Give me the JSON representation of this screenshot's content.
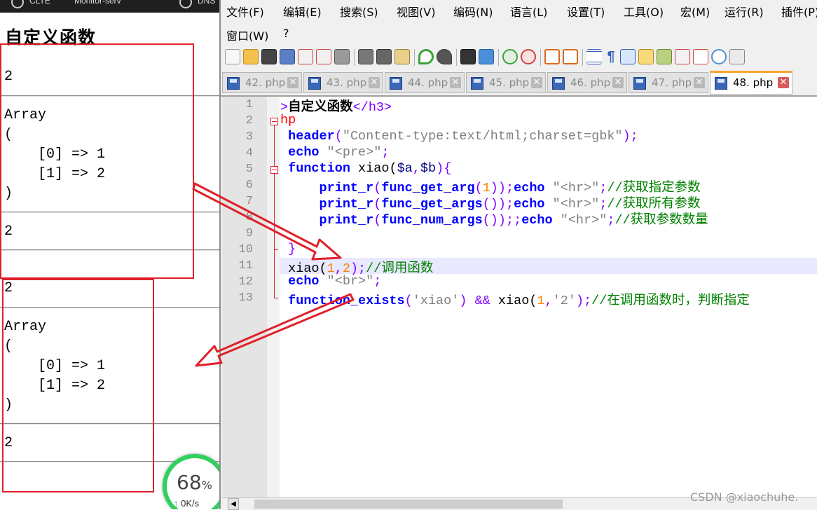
{
  "browser": {
    "tabs": [
      "CLTE",
      "Monitor-serv",
      "DNS"
    ],
    "heading": "自定义函数",
    "outputs": [
      "2",
      "Array\n(\n    [0] => 1\n    [1] => 2\n)",
      "2"
    ]
  },
  "network_widget": {
    "percent": "68",
    "percent_unit": "%",
    "speed": "0K/s"
  },
  "editor": {
    "menus": [
      "文件(F)",
      "编辑(E)",
      "搜索(S)",
      "视图(V)",
      "编码(N)",
      "语言(L)",
      "设置(T)",
      "工具(O)",
      "宏(M)",
      "运行(R)",
      "插件(P)",
      "窗口(W)",
      "?"
    ],
    "tabs": [
      "42. php",
      "43. php",
      "44. php",
      "45. php",
      "46. php",
      "47. php",
      "48. php"
    ],
    "active_tab": "48. php",
    "line_numbers": [
      "1",
      "2",
      "3",
      "4",
      "5",
      "6",
      "7",
      "8",
      "9",
      "10",
      "11",
      "12",
      "13"
    ],
    "code": {
      "l1": {
        "gt": ">",
        "text": "自定义函数",
        "close_tag": "</h3>"
      },
      "l2": {
        "text": "hp"
      },
      "l3": {
        "fn": "header",
        "open": "(",
        "str": "\"Content-type:text/html;charset=gbk\"",
        "close": ");"
      },
      "l4": {
        "kw": "echo",
        "str": "\"<pre>\"",
        "end": ";"
      },
      "l5": {
        "kw": "function",
        "name": " xiao(",
        "var_a": "$a",
        "comma": ",",
        "var_b": "$b",
        "end": "){"
      },
      "l6": {
        "fn1": "print_r",
        "p1": "(",
        "fn2": "func_get_arg",
        "p2": "(",
        "num": "1",
        "p3": "));",
        "kw": "echo",
        "str": " \"<hr>\"",
        "semi": ";",
        "comment": "//获取指定参数"
      },
      "l7": {
        "fn1": "print_r",
        "p1": "(",
        "fn2": "func_get_args",
        "p2": "());",
        "kw": "echo",
        "str": " \"<hr>\"",
        "semi": ";",
        "comment": "//获取所有参数"
      },
      "l8": {
        "fn1": "print_r",
        "p1": "(",
        "fn2": "func_num_args",
        "p2": "());;",
        "kw": "echo",
        "str": " \"<hr>\"",
        "semi": ";",
        "comment": "//获取参数数量"
      },
      "l10": {
        "brace": "}"
      },
      "l11": {
        "call": "xiao(",
        "n1": "1",
        "comma": ",",
        "n2": "2",
        "end": ");",
        "comment": "//调用函数"
      },
      "l12": {
        "kw": "echo",
        "str": " \"<br>\"",
        "end": ";"
      },
      "l13": {
        "kw": "function_exists",
        "open": "(",
        "str1": "'xiao'",
        "mid": ") && ",
        "call": "xiao(",
        "n1": "1",
        "comma": ",",
        "str2": "'2'",
        "end": ");",
        "comment": "//在调用函数时，判断指定"
      }
    }
  },
  "watermark": "CSDN @xiaochuhe.",
  "colors": {
    "annotation_red": "#e0212a",
    "tab_active_accent": "#f7a532",
    "current_line": "#e8e8ff"
  }
}
